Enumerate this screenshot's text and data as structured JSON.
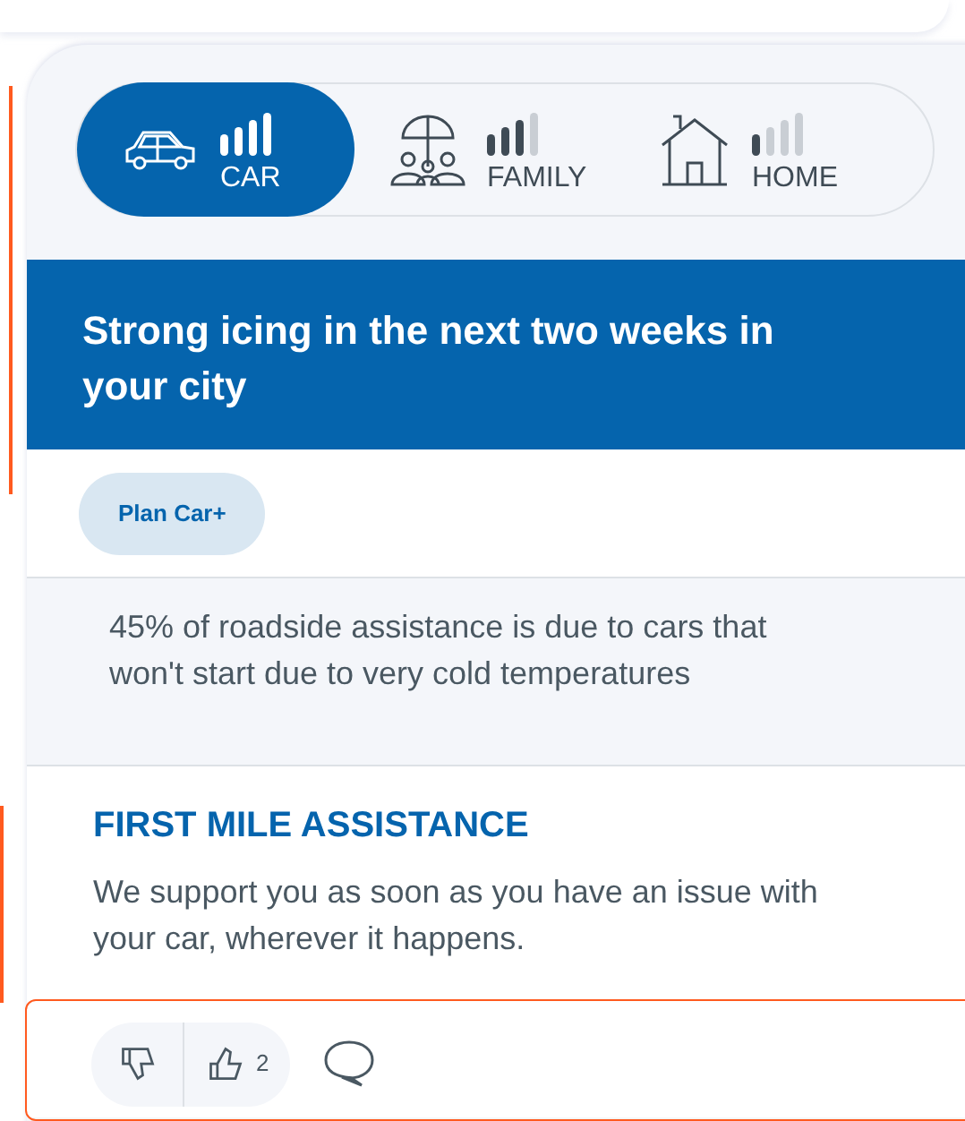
{
  "categories": [
    {
      "kind": "car",
      "label": "CAR",
      "selected": true
    },
    {
      "kind": "family",
      "label": "FAMILY",
      "selected": false
    },
    {
      "kind": "home",
      "label": "HOME",
      "selected": false
    }
  ],
  "alert": {
    "title": "Strong icing in the next two weeks in your city"
  },
  "plan_tag": "Plan Car+",
  "fact": "45% of roadside assistance is due to cars that won't start due to very cold temperatures",
  "service": {
    "title": "FIRST MILE ASSISTANCE",
    "description": "We support you as soon as you have an issue with your car, wherever it happens."
  },
  "reactions": {
    "likes": "2"
  }
}
